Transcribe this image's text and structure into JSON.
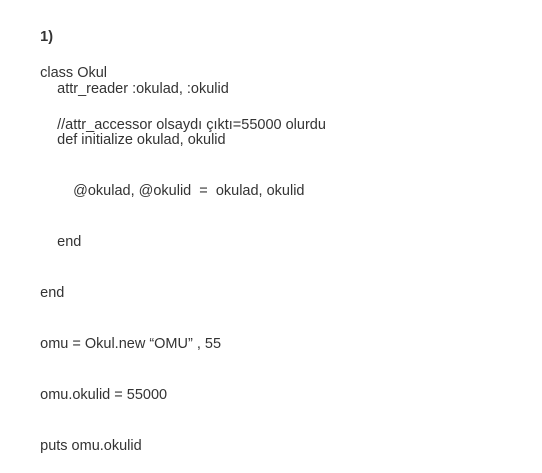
{
  "lines": {
    "number": "1)",
    "class_def": "class Okul",
    "attr_reader": "attr_reader :okulad, :okulid",
    "comment": "//attr_accessor olsaydı çıktı=55000 olurdu",
    "def_init": "def initialize okulad, okulid",
    "assign": "@okulad, @okulid  =  okulad, okulid",
    "end_inner": "end",
    "end_outer": "end",
    "new_obj": "omu = Okul.new “OMU” , 55",
    "set_id": "omu.okulid = 55000",
    "puts": "puts omu.okulid"
  }
}
